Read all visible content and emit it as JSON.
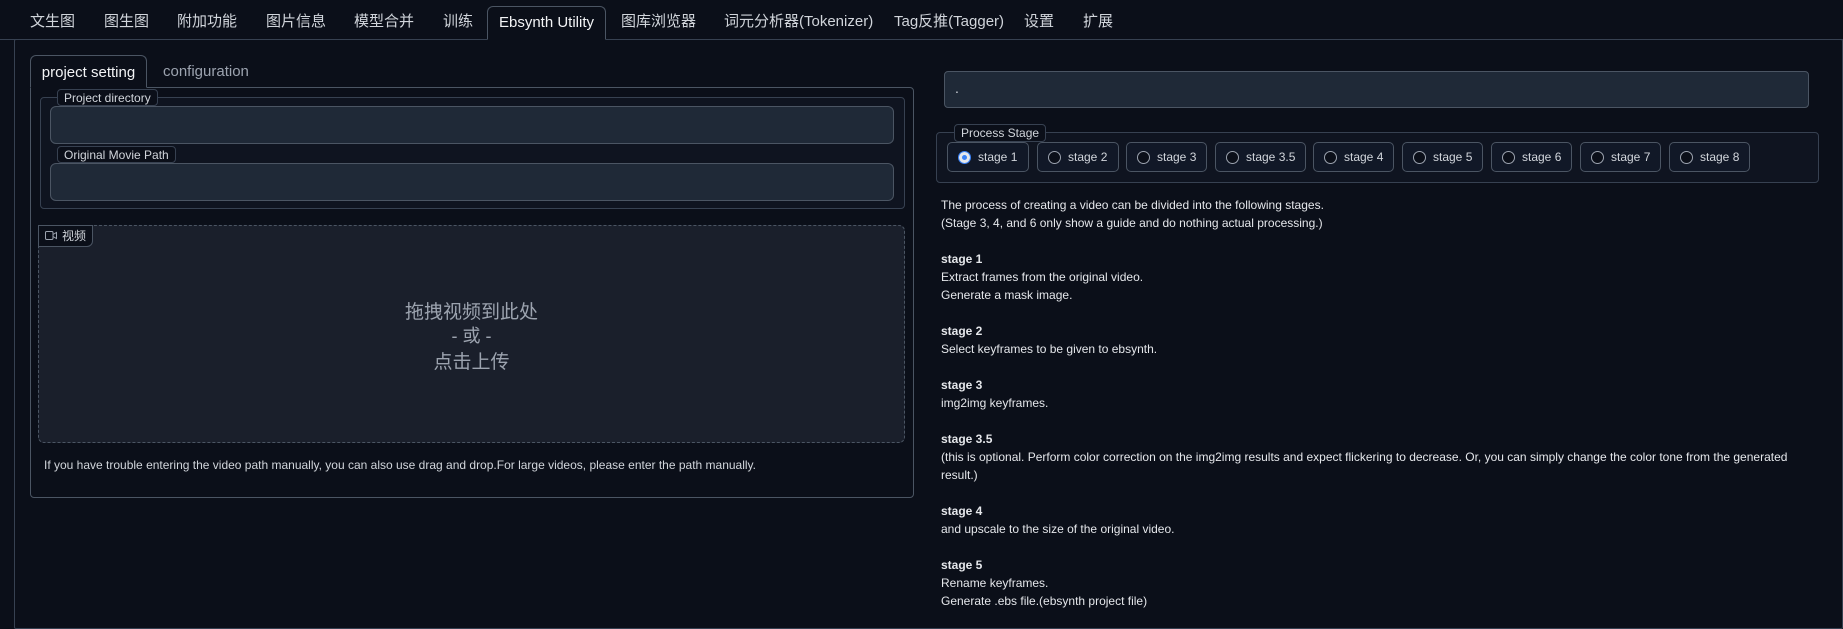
{
  "top_tabs": [
    {
      "label": "文生图"
    },
    {
      "label": "图生图"
    },
    {
      "label": "附加功能"
    },
    {
      "label": "图片信息"
    },
    {
      "label": "模型合并"
    },
    {
      "label": "训练"
    },
    {
      "label": "Ebsynth Utility",
      "active": true
    },
    {
      "label": "图库浏览器"
    },
    {
      "label": "词元分析器(Tokenizer)"
    },
    {
      "label": "Tag反推(Tagger)"
    },
    {
      "label": "设置"
    },
    {
      "label": "扩展"
    }
  ],
  "left_tabs": [
    {
      "label": "project setting",
      "active": true
    },
    {
      "label": "configuration"
    }
  ],
  "project_directory": {
    "label": "Project directory",
    "value": ""
  },
  "original_movie_path": {
    "label": "Original Movie Path",
    "value": ""
  },
  "video_upload": {
    "label": "视频",
    "line1": "拖拽视频到此处",
    "line2": "- 或 -",
    "line3": "点击上传"
  },
  "help_text": "If you have trouble entering the video path manually, you can also use drag and drop.For large videos, please enter the path manually.",
  "status_output": ".",
  "process_stage": {
    "label": "Process Stage",
    "selected": "stage 1",
    "options": [
      "stage 1",
      "stage 2",
      "stage 3",
      "stage 3.5",
      "stage 4",
      "stage 5",
      "stage 6",
      "stage 7",
      "stage 8"
    ]
  },
  "description": {
    "intro1": "The process of creating a video can be divided into the following stages.",
    "intro2": "(Stage 3, 4, and 6 only show a guide and do nothing actual processing.)",
    "s1_title": "stage 1",
    "s1_l1": "Extract frames from the original video.",
    "s1_l2": "Generate a mask image.",
    "s2_title": "stage 2",
    "s2_l1": "Select keyframes to be given to ebsynth.",
    "s3_title": "stage 3",
    "s3_l1": "img2img keyframes.",
    "s35_title": "stage 3.5",
    "s35_l1": "(this is optional. Perform color correction on the img2img results and expect flickering to decrease. Or, you can simply change the color tone from the generated",
    "s35_l2": "result.)",
    "s4_title": "stage 4",
    "s4_l1": "and upscale to the size of the original video.",
    "s5_title": "stage 5",
    "s5_l1": "Rename keyframes.",
    "s5_l2": "Generate .ebs file.(ebsynth project file)"
  },
  "colors": {
    "background": "#0b0f19",
    "accent": "#3b82f6",
    "border": "#374151"
  }
}
